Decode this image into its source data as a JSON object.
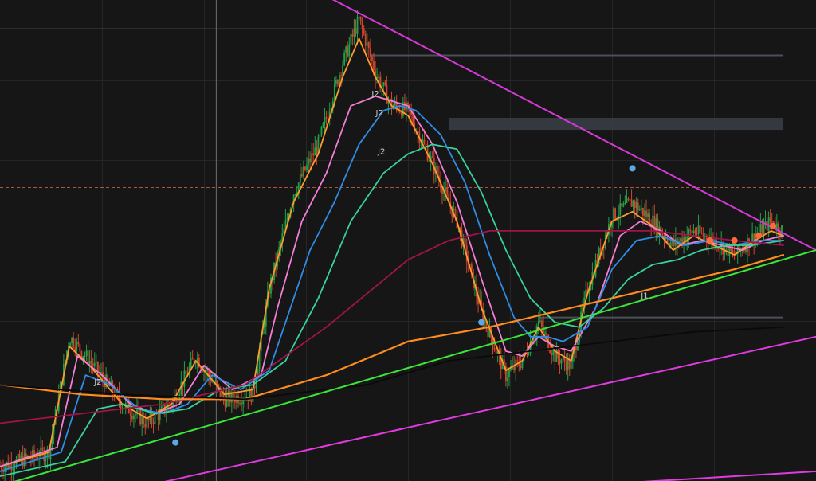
{
  "colors": {
    "background": "#161616",
    "grid": "#262626",
    "candle_up": "#1fa34a",
    "candle_down": "#d4452f",
    "crosshair": "#6f6f6f",
    "price_line": "#b5523a",
    "zone": "#3a3f48",
    "trendline_upper": "#d63ad6",
    "trendline_support": "#39e639",
    "channel": "#e23ae2",
    "label_text": "#cfcfcf",
    "dot_blue": "#5aa9e6",
    "dot_orange": "#ff6a3d"
  },
  "chart_data": {
    "type": "line",
    "title": "",
    "xlabel": "",
    "ylabel": "",
    "grid": true,
    "legend": "none",
    "xlim": [
      0,
      200
    ],
    "ylim": [
      0,
      100
    ],
    "candles": {
      "keyframes": [
        [
          0,
          3
        ],
        [
          12,
          6
        ],
        [
          17,
          30
        ],
        [
          22,
          25
        ],
        [
          30,
          16
        ],
        [
          36,
          12
        ],
        [
          42,
          16
        ],
        [
          48,
          26
        ],
        [
          55,
          17
        ],
        [
          62,
          18
        ],
        [
          66,
          40
        ],
        [
          72,
          60
        ],
        [
          78,
          70
        ],
        [
          84,
          87
        ],
        [
          88,
          96
        ],
        [
          92,
          85
        ],
        [
          96,
          78
        ],
        [
          100,
          77
        ],
        [
          106,
          66
        ],
        [
          112,
          54
        ],
        [
          118,
          35
        ],
        [
          124,
          22
        ],
        [
          128,
          25
        ],
        [
          132,
          33
        ],
        [
          136,
          26
        ],
        [
          140,
          24
        ],
        [
          144,
          40
        ],
        [
          150,
          55
        ],
        [
          155,
          58
        ],
        [
          160,
          54
        ],
        [
          165,
          49
        ],
        [
          170,
          52
        ],
        [
          175,
          50
        ],
        [
          180,
          47
        ],
        [
          185,
          51
        ],
        [
          189,
          54
        ],
        [
          192,
          52
        ]
      ]
    },
    "series": [
      {
        "color": "#ff9a2b",
        "values": [
          [
            0,
            3
          ],
          [
            12,
            6
          ],
          [
            17,
            28
          ],
          [
            22,
            24
          ],
          [
            30,
            16
          ],
          [
            36,
            13
          ],
          [
            42,
            16
          ],
          [
            48,
            25
          ],
          [
            55,
            18
          ],
          [
            62,
            19
          ],
          [
            66,
            40
          ],
          [
            72,
            58
          ],
          [
            78,
            68
          ],
          [
            84,
            84
          ],
          [
            88,
            92
          ],
          [
            92,
            84
          ],
          [
            96,
            78
          ],
          [
            100,
            76
          ],
          [
            106,
            66
          ],
          [
            112,
            54
          ],
          [
            118,
            36
          ],
          [
            124,
            23
          ],
          [
            128,
            25
          ],
          [
            132,
            32
          ],
          [
            136,
            27
          ],
          [
            140,
            25
          ],
          [
            144,
            39
          ],
          [
            150,
            54
          ],
          [
            155,
            56
          ],
          [
            160,
            53
          ],
          [
            165,
            48
          ],
          [
            170,
            51
          ],
          [
            175,
            49
          ],
          [
            180,
            47
          ],
          [
            185,
            50
          ],
          [
            189,
            52
          ],
          [
            192,
            51
          ]
        ]
      },
      {
        "color": "#f47ed6",
        "values": [
          [
            0,
            3
          ],
          [
            14,
            7
          ],
          [
            19,
            26
          ],
          [
            25,
            22
          ],
          [
            32,
            16
          ],
          [
            38,
            14
          ],
          [
            44,
            16
          ],
          [
            50,
            24
          ],
          [
            57,
            19
          ],
          [
            64,
            22
          ],
          [
            68,
            36
          ],
          [
            74,
            54
          ],
          [
            80,
            64
          ],
          [
            86,
            78
          ],
          [
            92,
            80
          ],
          [
            96,
            79
          ],
          [
            100,
            78
          ],
          [
            106,
            70
          ],
          [
            112,
            58
          ],
          [
            118,
            42
          ],
          [
            124,
            27
          ],
          [
            128,
            26
          ],
          [
            132,
            30
          ],
          [
            136,
            28
          ],
          [
            140,
            27
          ],
          [
            146,
            36
          ],
          [
            152,
            51
          ],
          [
            157,
            54
          ],
          [
            162,
            52
          ],
          [
            167,
            49
          ],
          [
            172,
            50
          ],
          [
            177,
            49
          ],
          [
            182,
            48
          ],
          [
            187,
            50
          ],
          [
            192,
            51
          ]
        ]
      },
      {
        "color": "#2f8de6",
        "values": [
          [
            0,
            2
          ],
          [
            15,
            6
          ],
          [
            21,
            22
          ],
          [
            27,
            20
          ],
          [
            34,
            15
          ],
          [
            40,
            14
          ],
          [
            46,
            16
          ],
          [
            52,
            22
          ],
          [
            59,
            19
          ],
          [
            66,
            23
          ],
          [
            70,
            33
          ],
          [
            76,
            48
          ],
          [
            82,
            58
          ],
          [
            88,
            70
          ],
          [
            94,
            77
          ],
          [
            98,
            78
          ],
          [
            102,
            77
          ],
          [
            108,
            72
          ],
          [
            114,
            62
          ],
          [
            120,
            47
          ],
          [
            126,
            34
          ],
          [
            130,
            30
          ],
          [
            134,
            30
          ],
          [
            138,
            29
          ],
          [
            144,
            32
          ],
          [
            150,
            44
          ],
          [
            156,
            50
          ],
          [
            162,
            51
          ],
          [
            168,
            49
          ],
          [
            174,
            50
          ],
          [
            180,
            49
          ],
          [
            186,
            50
          ],
          [
            192,
            50
          ]
        ]
      },
      {
        "color": "#39d39a",
        "values": [
          [
            0,
            1
          ],
          [
            16,
            4
          ],
          [
            24,
            15
          ],
          [
            30,
            16
          ],
          [
            38,
            14
          ],
          [
            46,
            15
          ],
          [
            54,
            19
          ],
          [
            62,
            20
          ],
          [
            70,
            25
          ],
          [
            78,
            38
          ],
          [
            86,
            54
          ],
          [
            94,
            64
          ],
          [
            100,
            68
          ],
          [
            106,
            70
          ],
          [
            112,
            69
          ],
          [
            118,
            60
          ],
          [
            124,
            48
          ],
          [
            130,
            38
          ],
          [
            136,
            33
          ],
          [
            142,
            32
          ],
          [
            148,
            36
          ],
          [
            154,
            42
          ],
          [
            160,
            45
          ],
          [
            166,
            46
          ],
          [
            172,
            48
          ],
          [
            178,
            49
          ],
          [
            184,
            49
          ],
          [
            192,
            50
          ]
        ]
      },
      {
        "color": "#a0144a",
        "values": [
          [
            0,
            12
          ],
          [
            20,
            14
          ],
          [
            40,
            16
          ],
          [
            60,
            20
          ],
          [
            80,
            32
          ],
          [
            100,
            46
          ],
          [
            110,
            50
          ],
          [
            120,
            52
          ],
          [
            140,
            52
          ],
          [
            160,
            52
          ],
          [
            180,
            50
          ],
          [
            192,
            49
          ]
        ]
      },
      {
        "color": "#ff8c1f",
        "values": [
          [
            0,
            20
          ],
          [
            20,
            18
          ],
          [
            40,
            17
          ],
          [
            60,
            17
          ],
          [
            80,
            22
          ],
          [
            100,
            29
          ],
          [
            120,
            32
          ],
          [
            140,
            36
          ],
          [
            160,
            40
          ],
          [
            180,
            44
          ],
          [
            192,
            47
          ]
        ]
      },
      {
        "color": "#0a0a0a",
        "values": [
          [
            0,
            20
          ],
          [
            30,
            18
          ],
          [
            60,
            17
          ],
          [
            90,
            20
          ],
          [
            110,
            25
          ],
          [
            130,
            27
          ],
          [
            150,
            29
          ],
          [
            170,
            31
          ],
          [
            192,
            32
          ]
        ]
      }
    ],
    "trendlines": [
      {
        "color": "#d63ad6",
        "from": [
          75,
          103
        ],
        "to": [
          200,
          48
        ]
      },
      {
        "color": "#39e639",
        "from": [
          0,
          -1
        ],
        "to": [
          200,
          48
        ]
      },
      {
        "color": "#e23ae2",
        "from": [
          20,
          -4
        ],
        "to": [
          200,
          30
        ]
      },
      {
        "color": "#e23ae2",
        "from": [
          82,
          -4
        ],
        "to": [
          200,
          2
        ]
      }
    ],
    "horizontal_lines": [
      {
        "color": "#4a4f58",
        "y": 88.5,
        "x_from": 91,
        "x_to": 192
      },
      {
        "color": "#4a4f58",
        "y": 34,
        "x_from": 132,
        "x_to": 192
      }
    ],
    "zones": [
      {
        "color": "#3a3f48",
        "y_from": 73,
        "y_to": 75.5,
        "x_from": 110,
        "x_to": 192
      }
    ],
    "price_line": {
      "y": 61
    },
    "crosshair": {
      "x": 53,
      "y": 94
    },
    "dots": [
      {
        "color": "#5aa9e6",
        "x": 43,
        "y": 8
      },
      {
        "color": "#5aa9e6",
        "x": 118,
        "y": 33
      },
      {
        "color": "#5aa9e6",
        "x": 155,
        "y": 65
      },
      {
        "color": "#ff6a3d",
        "x": 174,
        "y": 50
      },
      {
        "color": "#ff6a3d",
        "x": 180,
        "y": 50
      },
      {
        "color": "#ff6a3d",
        "x": 186,
        "y": 51
      },
      {
        "color": "#ff6a3d",
        "x": 189.5,
        "y": 53
      }
    ],
    "labels": [
      {
        "text": "J2",
        "x": 24,
        "y": 20
      },
      {
        "text": "J2",
        "x": 92,
        "y": 80
      },
      {
        "text": "J2",
        "x": 93,
        "y": 76
      },
      {
        "text": "J2",
        "x": 93.5,
        "y": 68
      },
      {
        "text": "J1",
        "x": 158,
        "y": 38
      }
    ]
  }
}
